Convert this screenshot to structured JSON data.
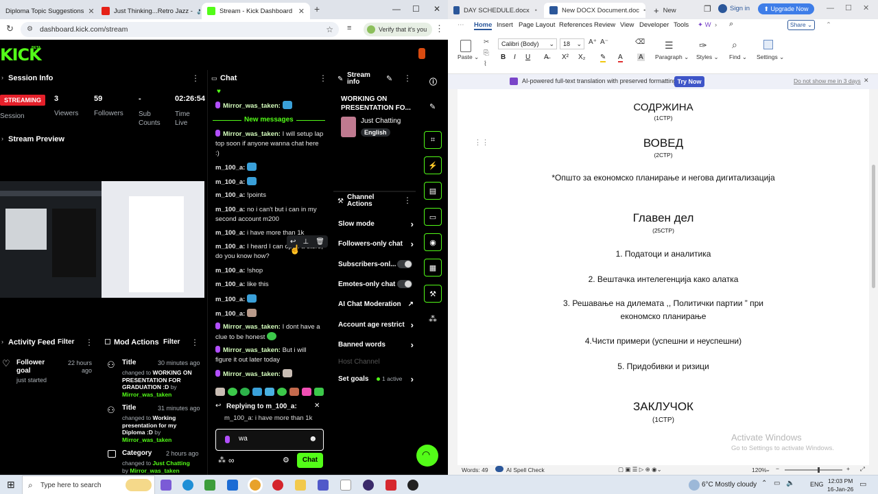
{
  "browser": {
    "tabs": [
      {
        "title": "Diploma Topic Suggestions",
        "active": false
      },
      {
        "title": "Just Thinking...Retro Jazz -",
        "active": false
      },
      {
        "title": "Stream - Kick Dashboard",
        "active": true
      }
    ],
    "url": "dashboard.kick.com/stream",
    "verify_label": "Verify that it's you"
  },
  "kick": {
    "logo": "KICK",
    "logo_beta": "BETA",
    "session": {
      "title": "Session Info",
      "status": "STREAMING",
      "status_sub": "Session",
      "viewers_value": "3",
      "viewers_label": "Viewers",
      "followers_value": "59",
      "followers_label": "Followers",
      "subs_value": "-",
      "subs_label": "Sub Counts",
      "time_value": "02:26:54",
      "time_label": "Time Live"
    },
    "preview_title": "Stream Preview",
    "activity": {
      "title": "Activity Feed",
      "filter": "Filter",
      "item_title": "Follower goal",
      "item_sub": "just started",
      "item_time": "22 hours ago"
    },
    "mod": {
      "title": "Mod Actions",
      "filter": "Filter",
      "items": [
        {
          "type": "Title",
          "time": "30 minutes ago",
          "text_pre": "changed to",
          "value": "WORKING ON PRESENTATION FOR GRADUATION :D",
          "by": "by",
          "user": "Mirror_was_taken"
        },
        {
          "type": "Title",
          "time": "31 minutes ago",
          "text_pre": "changed to",
          "value": "Working presentation for my Diploma :D",
          "by": "by",
          "user": "Mirror_was_taken"
        },
        {
          "type": "Category",
          "time": "2 hours ago",
          "text_pre": "changed to",
          "value": "Just Chatting",
          "by": "by",
          "user": "Mirror_was_taken"
        }
      ]
    },
    "chat": {
      "title": "Chat",
      "new_messages": "New messages",
      "messages": [
        {
          "user": "Mirror_was_taken:",
          "text": "",
          "mod": true
        },
        {
          "user": "Mirror_was_taken:",
          "text": "I will setup lap top soon if anyone wanna chat here :)",
          "mod": true
        },
        {
          "user": "m_100_a:",
          "text": "",
          "mod": false
        },
        {
          "user": "m_100_a:",
          "text": "",
          "mod": false
        },
        {
          "user": "m_100_a:",
          "text": "!points",
          "mod": false
        },
        {
          "user": "m_100_a:",
          "text": "no i can't but i can in my second account m200",
          "mod": false
        },
        {
          "user": "m_100_a:",
          "text": "i have more than 1k",
          "mod": false
        },
        {
          "user": "m_100_a:",
          "text": "I heard I can open a store, do you know how?",
          "mod": false
        },
        {
          "user": "m_100_a:",
          "text": "!shop",
          "mod": false
        },
        {
          "user": "m_100_a:",
          "text": "like this",
          "mod": false
        },
        {
          "user": "m_100_a:",
          "text": "",
          "mod": false
        },
        {
          "user": "m_100_a:",
          "text": "",
          "mod": false
        },
        {
          "user": "Mirror_was_taken:",
          "text": "I dont have a clue to be honest",
          "mod": true
        },
        {
          "user": "Mirror_was_taken:",
          "text": "But i will figure it out later today",
          "mod": true
        },
        {
          "user": "Mirror_was_taken:",
          "text": "",
          "mod": true
        }
      ],
      "replying_label": "Replying to m_100_a:",
      "replying_text": "m_100_a: i have more than 1k",
      "input_value": "wa",
      "send_label": "Chat"
    },
    "stream_info": {
      "title": "Stream info",
      "stream_title": "WORKING ON PRESENTATION FO...",
      "category": "Just Chatting",
      "language": "English"
    },
    "channel_actions": {
      "title": "Channel Actions",
      "items": [
        {
          "label": "Slow mode",
          "control": "chevron"
        },
        {
          "label": "Followers-only chat",
          "control": "chevron"
        },
        {
          "label": "Subscribers-onl...",
          "control": "toggle"
        },
        {
          "label": "Emotes-only chat",
          "control": "toggle"
        },
        {
          "label": "AI Chat Moderation",
          "control": "external"
        },
        {
          "label": "Account age restrict",
          "control": "chevron"
        },
        {
          "label": "Banned words",
          "control": "chevron"
        },
        {
          "label": "Host Channel",
          "control": "none"
        },
        {
          "label": "Set goals",
          "control": "chevron",
          "extra": "1 active"
        }
      ]
    }
  },
  "word": {
    "tabs": [
      {
        "title": "DAY SCHEDULE.docx",
        "active": false
      },
      {
        "title": "New DOCX Document.doc",
        "active": true
      },
      {
        "title": "New",
        "active": false
      }
    ],
    "signin": "Sign in",
    "upgrade": "Upgrade Now",
    "ribbon_tabs": [
      "Home",
      "Insert",
      "Page Layout",
      "References",
      "Review",
      "View",
      "Developer",
      "Tools",
      "W"
    ],
    "share": "Share",
    "font_name": "Calibri (Body)",
    "font_size": "18",
    "paste_label": "Paste",
    "paragraph_label": "Paragraph",
    "styles_label": "Styles",
    "find_label": "Find",
    "settings_label": "Settings",
    "translation_text": "AI-powered full-text translation with preserved formatting.",
    "try_now": "Try Now",
    "dont_show": "Do not show me in 3 days",
    "doc_lines": [
      "СОДРЖИНА",
      "(1СТР)",
      "ВОВЕД",
      "(2СТР)",
      "*Општо за економско планирање и негова дигитализација",
      "Главен дел",
      "(25СТР)",
      "1. Податоци и аналитика",
      "2. Вештачка интелегенција како алатка",
      "3. Решавање на дилемата ,, Политички партии ” при",
      "економско планирање",
      "4.Чисти примери (успешни и неуспешни)",
      "5. Придобивки и ризици",
      "ЗАКЛУЧОК",
      "(1СТР)"
    ],
    "watermark_title": "Activate Windows",
    "watermark_sub": "Go to Settings to activate Windows.",
    "words": "Words: 49",
    "spellcheck": "AI Spell Check",
    "zoom": "120%"
  },
  "taskbar": {
    "search_placeholder": "Type here to search",
    "weather": "6°C  Mostly cloudy",
    "lang": "ENG",
    "time": "12:03 PM",
    "date": "16-Jan-26"
  },
  "colors": {
    "kick_green": "#53fc18",
    "live_red": "#e5202a",
    "word_blue": "#2b579a"
  }
}
